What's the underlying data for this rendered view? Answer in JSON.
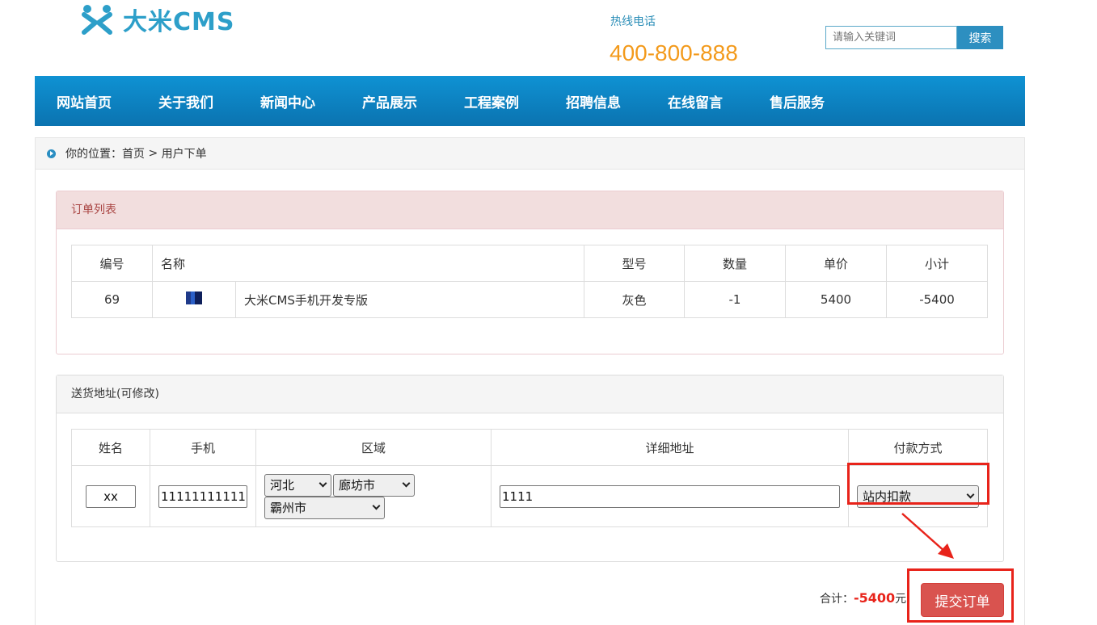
{
  "header": {
    "logo_text": "大米CMS",
    "hotline_label": "热线电话",
    "hotline_number": "400-800-888",
    "search_placeholder": "请输入关键词",
    "search_button": "搜索"
  },
  "nav": [
    "网站首页",
    "关于我们",
    "新闻中心",
    "产品展示",
    "工程案例",
    "招聘信息",
    "在线留言",
    "售后服务"
  ],
  "breadcrumb": {
    "label": "你的位置：",
    "home": "首页",
    "separator": " > ",
    "current": "用户下单"
  },
  "order_panel": {
    "title": "订单列表",
    "headers": [
      "编号",
      "名称",
      "型号",
      "数量",
      "单价",
      "小计"
    ],
    "row": {
      "id": "69",
      "name": "大米CMS手机开发专版",
      "model": "灰色",
      "qty": "-1",
      "price": "5400",
      "subtotal": "-5400"
    }
  },
  "address_panel": {
    "title": "送货地址(可修改)",
    "headers": [
      "姓名",
      "手机",
      "区域",
      "详细地址",
      "付款方式"
    ],
    "name": "xx",
    "phone": "11111111111",
    "province": "河北",
    "city": "廊坊市",
    "district": "霸州市",
    "address": "1111",
    "payment": "站内扣款"
  },
  "summary": {
    "label": "合计：",
    "amount": "-5400",
    "unit": "元",
    "submit": "提交订单"
  },
  "colors": {
    "nav": "#0b82c2",
    "accent_orange": "#f39a1b",
    "danger": "#d9534f",
    "highlight": "#e8231a"
  }
}
